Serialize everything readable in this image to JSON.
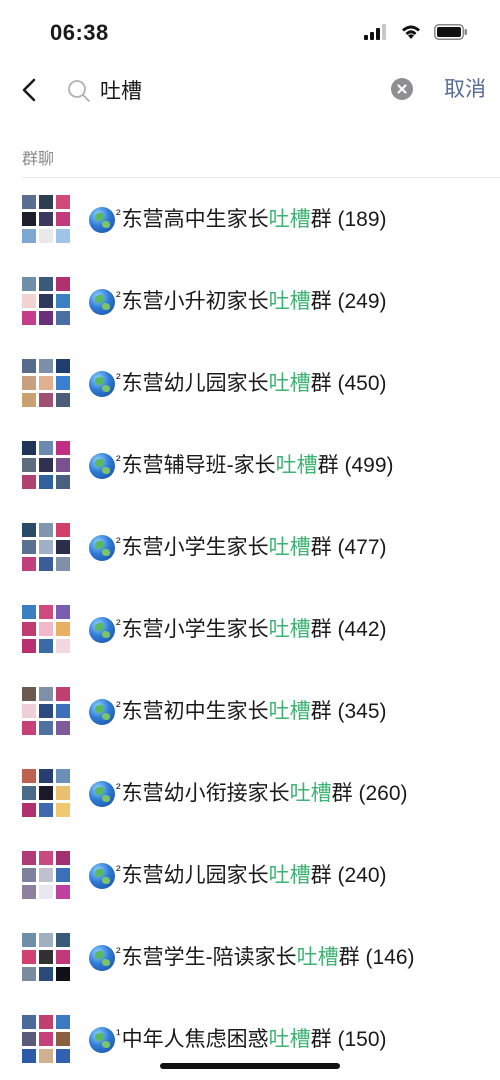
{
  "status_bar": {
    "time": "06:38",
    "icons": [
      "signal-icon",
      "wifi-icon",
      "battery-icon"
    ]
  },
  "search": {
    "back_icon": "chevron-left-icon",
    "search_icon": "search-icon",
    "query": "吐槽",
    "clear_icon": "clear-icon",
    "cancel_label": "取消"
  },
  "section": {
    "title": "群聊"
  },
  "colors": {
    "highlight": "#3cb371",
    "link_blue": "#576b95",
    "meta_gray": "#8a8a8a"
  },
  "results": [
    {
      "sup": "²",
      "pre": "东营高中生家长",
      "hl": "吐槽",
      "post": "群 (189)",
      "avatar": [
        "#5a6f8f",
        "#2c3e50",
        "#d04a7a",
        "#1d1d2b",
        "#3a3a5c",
        "#c23b7d",
        "#7ba7d0",
        "#e9e9e9",
        "#a0c4e8"
      ]
    },
    {
      "sup": "²",
      "pre": "东营小升初家长",
      "hl": "吐槽",
      "post": "群 (249)",
      "avatar": [
        "#6f8fa8",
        "#3a5a7a",
        "#b03070",
        "#f2d3d3",
        "#2e3a5c",
        "#3d7fc4",
        "#c43d8a",
        "#6a2f7a",
        "#4a6fa5"
      ]
    },
    {
      "sup": "²",
      "pre": "东营幼儿园家长",
      "hl": "吐槽",
      "post": "群 (450)",
      "avatar": [
        "#556b8a",
        "#7a8fa8",
        "#1f3f6f",
        "#c8a080",
        "#e0b090",
        "#3b7fd0",
        "#caa070",
        "#a05070",
        "#4b5d7a"
      ]
    },
    {
      "sup": "²",
      "pre": "东营辅导班-家长",
      "hl": "吐槽",
      "post": "群 (499)",
      "avatar": [
        "#1d3557",
        "#6a8ab0",
        "#c03080",
        "#5d6d7d",
        "#303050",
        "#7a5090",
        "#b04070",
        "#3060a0",
        "#4a6080"
      ]
    },
    {
      "sup": "²",
      "pre": "东营小学生家长",
      "hl": "吐槽",
      "post": "群 (477)",
      "avatar": [
        "#2a4a6a",
        "#7f95b0",
        "#d0406a",
        "#5a7090",
        "#a0b0c8",
        "#2c2c4c",
        "#c0407c",
        "#3b5e9a",
        "#8090a8"
      ]
    },
    {
      "sup": "²",
      "pre": "东营小学生家长",
      "hl": "吐槽",
      "post": "群 (442)",
      "avatar": [
        "#3c7fc0",
        "#d04a80",
        "#7a5fb0",
        "#c03c70",
        "#f0b8c8",
        "#e8b060",
        "#b83070",
        "#3a6aa8",
        "#f4d8e0"
      ]
    },
    {
      "sup": "²",
      "pre": "东营初中生家长",
      "hl": "吐槽",
      "post": "群 (345)",
      "avatar": [
        "#6a5a50",
        "#7f90a8",
        "#c04070",
        "#f0d0d8",
        "#2a4a80",
        "#3d70b8",
        "#c8407a",
        "#5070a0",
        "#7f5a9a"
      ]
    },
    {
      "sup": "²",
      "pre": "东营幼小衔接家长",
      "hl": "吐槽",
      "post": "群 (260)",
      "avatar": [
        "#c06050",
        "#2a3f6f",
        "#6a90b8",
        "#4a6a8a",
        "#1a1a2a",
        "#e8c070",
        "#b03070",
        "#3f6ab0",
        "#f0c870"
      ]
    },
    {
      "sup": "²",
      "pre": "东营幼儿园家长",
      "hl": "吐槽",
      "post": "群 (240)",
      "avatar": [
        "#b03a78",
        "#c84a80",
        "#a03070",
        "#7f7f9f",
        "#c0c0d0",
        "#3a70b8",
        "#9080a0",
        "#e8e8f0",
        "#c040a0"
      ]
    },
    {
      "sup": "²",
      "pre": "东营学生-陪读家长",
      "hl": "吐槽",
      "post": "群 (146)",
      "avatar": [
        "#6f8fa8",
        "#a0b0c0",
        "#3a5a7a",
        "#d04070",
        "#303030",
        "#c03878",
        "#7a8aa0",
        "#2a4a7a",
        "#101018"
      ]
    },
    {
      "sup": "¹",
      "pre": "中年人焦虑困惑",
      "hl": "吐槽",
      "post": "群 (150)",
      "avatar": [
        "#4a6a9a",
        "#c04070",
        "#3a7ac0",
        "#5a5a7a",
        "#c8407a",
        "#8a6040",
        "#2a5aa8",
        "#d0b090",
        "#3060b0"
      ]
    }
  ]
}
